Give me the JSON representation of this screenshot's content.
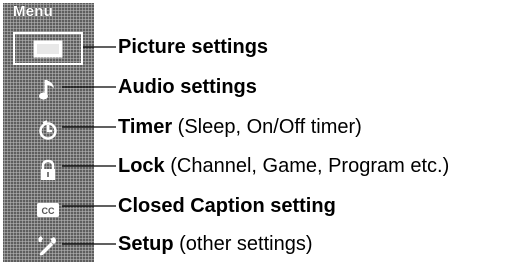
{
  "menu": {
    "title": "Menu",
    "items": [
      {
        "icon": "picture-icon",
        "name": "Picture settings",
        "detail": ""
      },
      {
        "icon": "music-note-icon",
        "name": "Audio settings",
        "detail": ""
      },
      {
        "icon": "timer-icon",
        "name": "Timer",
        "detail": " (Sleep, On/Off timer)"
      },
      {
        "icon": "lock-icon",
        "name": "Lock",
        "detail": " (Channel, Game, Program etc.)"
      },
      {
        "icon": "cc-icon",
        "name": "Closed Caption setting",
        "detail": ""
      },
      {
        "icon": "setup-icon",
        "name": "Setup",
        "detail": " (other settings)"
      }
    ],
    "selected_index": 0
  }
}
